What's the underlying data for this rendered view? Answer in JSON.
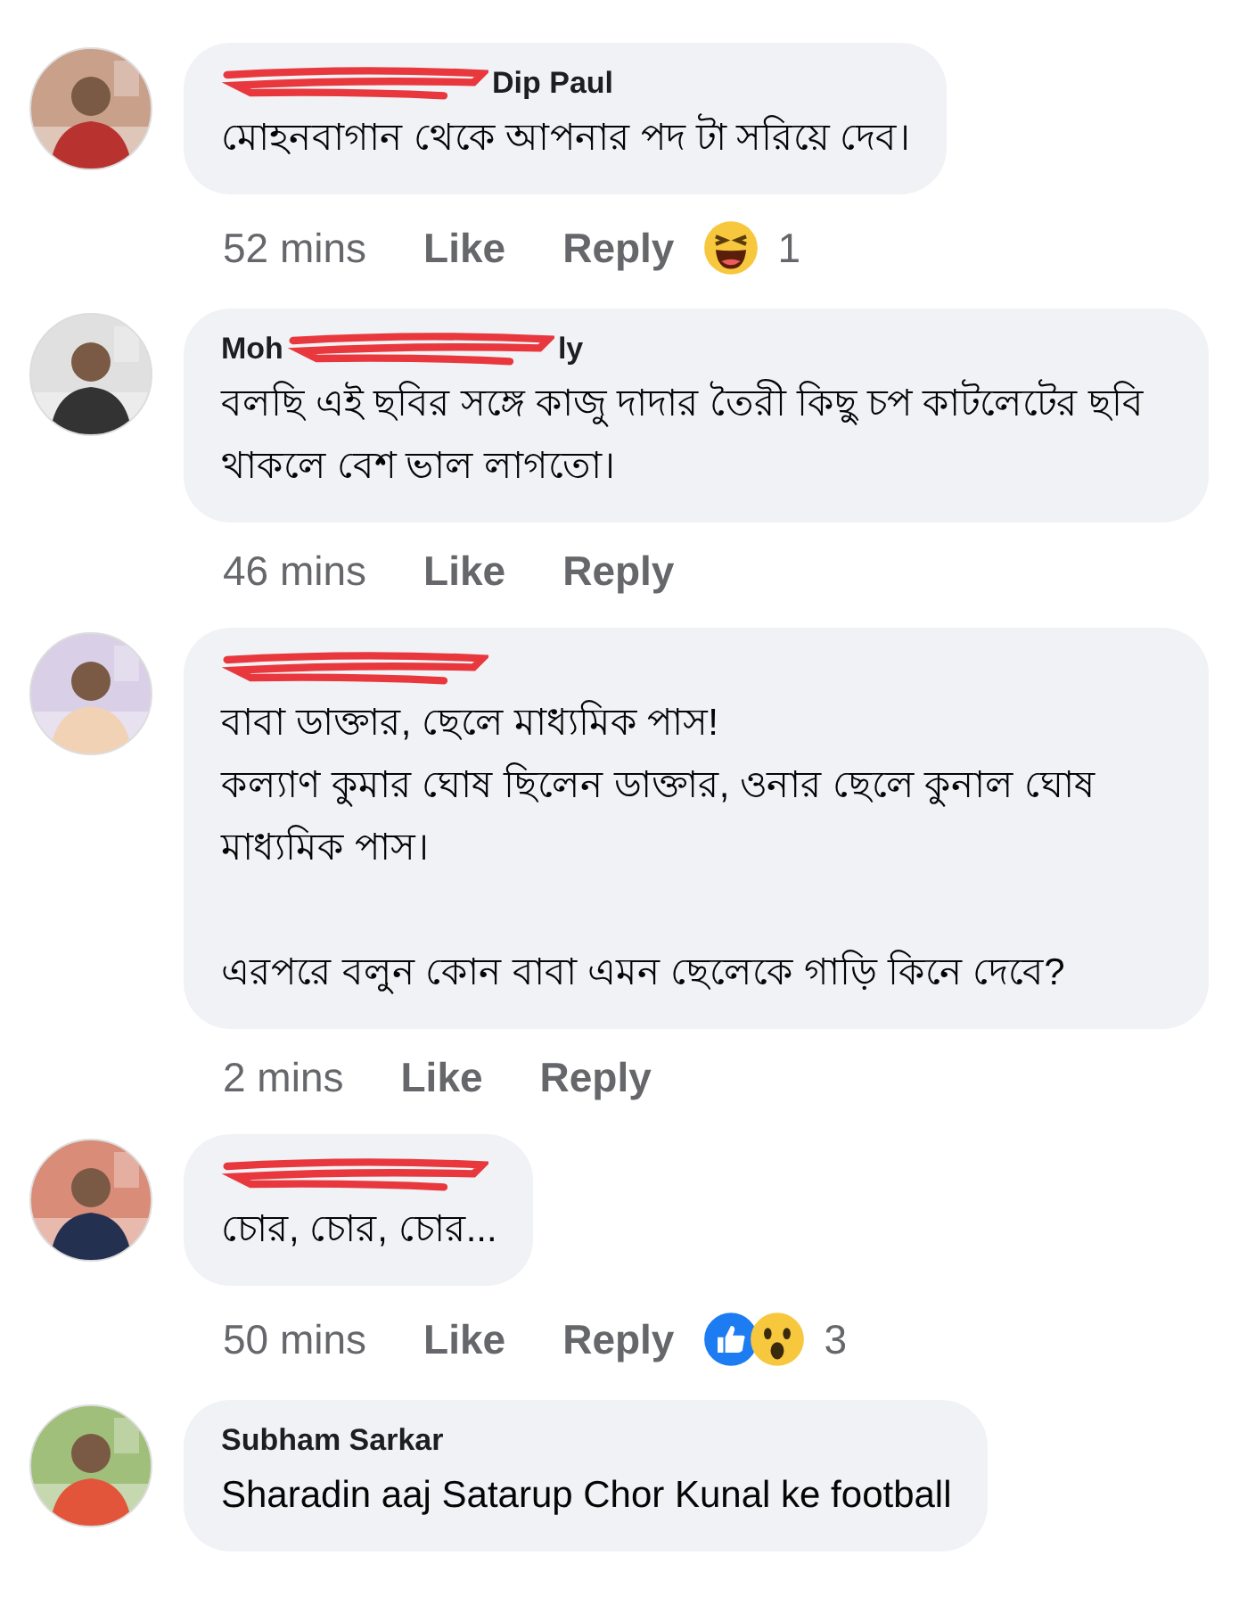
{
  "comments": [
    {
      "avatar": {
        "kind": "picture"
      },
      "name": [
        {
          "kind": "redacted"
        },
        {
          "kind": "text",
          "text": "Dip Paul"
        }
      ],
      "body": [
        "মোহনবাগান থেকে আপনার পদ টা সরিয়ে দেব।"
      ],
      "time": "52 mins",
      "like": "Like",
      "reply": "Reply",
      "reactions": [
        {
          "kind": "haha"
        }
      ],
      "reaction_count": "1"
    },
    {
      "avatar": {
        "kind": "picture"
      },
      "name": [
        {
          "kind": "text",
          "text": "Moh"
        },
        {
          "kind": "redacted"
        },
        {
          "kind": "text",
          "text": "ly"
        }
      ],
      "body": [
        "বলছি এই ছবির সঙ্গে কাজু দাদার তৈরী কিছু চপ কাটলেটের  ছবি থাকলে বেশ ভাল লাগতো।"
      ],
      "time": "46 mins",
      "like": "Like",
      "reply": "Reply"
    },
    {
      "avatar": {
        "kind": "picture"
      },
      "name": [
        {
          "kind": "redacted"
        }
      ],
      "body": [
        "বাবা ডাক্তার, ছেলে মাধ্যমিক পাস!\nকল্যাণ কুমার ঘোষ ছিলেন ডাক্তার, ওনার ছেলে কুনাল ঘোষ মাধ্যমিক পাস।",
        "এরপরে বলুন কোন বাবা এমন ছেলেকে গাড়ি কিনে দেবে?"
      ],
      "time": "2 mins",
      "like": "Like",
      "reply": "Reply"
    },
    {
      "avatar": {
        "kind": "picture"
      },
      "name": [
        {
          "kind": "redacted"
        }
      ],
      "body": [
        "চোর, চোর, চোর..."
      ],
      "time": "50 mins",
      "like": "Like",
      "reply": "Reply",
      "reactions": [
        {
          "kind": "like"
        },
        {
          "kind": "wow"
        }
      ],
      "reaction_count": "3"
    },
    {
      "avatar": {
        "kind": "picture"
      },
      "name": [
        {
          "kind": "text",
          "text": "Subham Sarkar"
        }
      ],
      "body": [
        "Sharadin aaj Satarup Chor Kunal ke football"
      ]
    }
  ]
}
